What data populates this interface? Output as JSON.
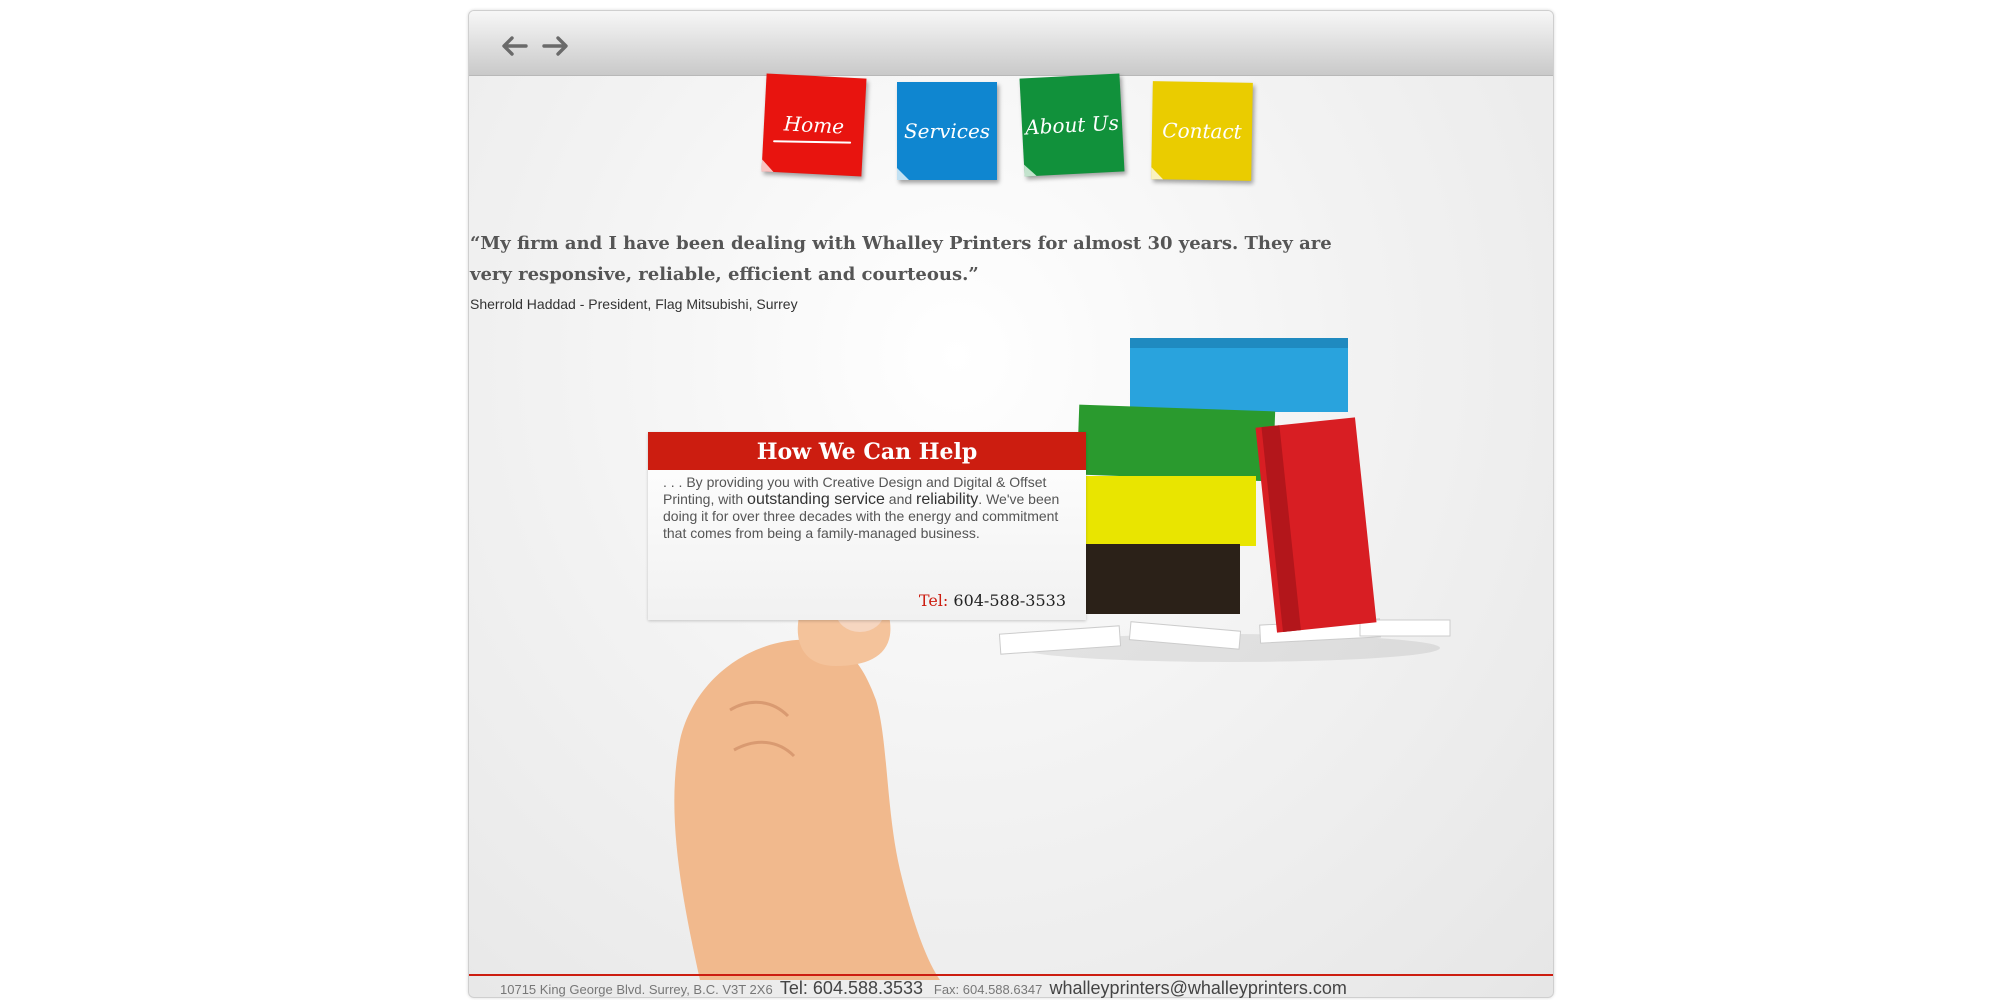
{
  "nav": {
    "items": [
      {
        "label": "Home",
        "color": "#e8140f",
        "active": true
      },
      {
        "label": "Services",
        "color": "#0f86d0",
        "active": false
      },
      {
        "label": "About Us",
        "color": "#11913b",
        "active": false
      },
      {
        "label": "Contact",
        "color": "#eacc00",
        "active": false
      }
    ]
  },
  "testimonial": {
    "quote": "“My firm and I have been dealing with Whalley Printers for almost 30 years. They are very responsive, reliable, efficient and courteous.”",
    "author": "Sherrold Haddad - President, Flag Mitsubishi, Surrey"
  },
  "help_card": {
    "title": "How We Can Help",
    "text_1": ". . . By providing you with Creative Design and Digital & Offset Printing, with",
    "emphasis_1": "outstanding service",
    "text_2": "and",
    "emphasis_2": "reliability",
    "text_3": ". We've been doing it for over three decades with the energy and commitment that comes from being a family-managed business.",
    "tel_label": "Tel:",
    "tel": "604-588-3533"
  },
  "footer": {
    "address": "10715 King George Blvd. Surrey, B.C. V3T 2X6",
    "tel": "Tel: 604.588.3533",
    "fax": "Fax: 604.588.6347",
    "email": "whalleyprinters@whalleyprinters.com"
  },
  "icons": [
    "back-arrow-icon",
    "forward-arrow-icon",
    "hand-image",
    "product-boxes-image"
  ],
  "colors": {
    "accent_red": "#cc1d10"
  }
}
